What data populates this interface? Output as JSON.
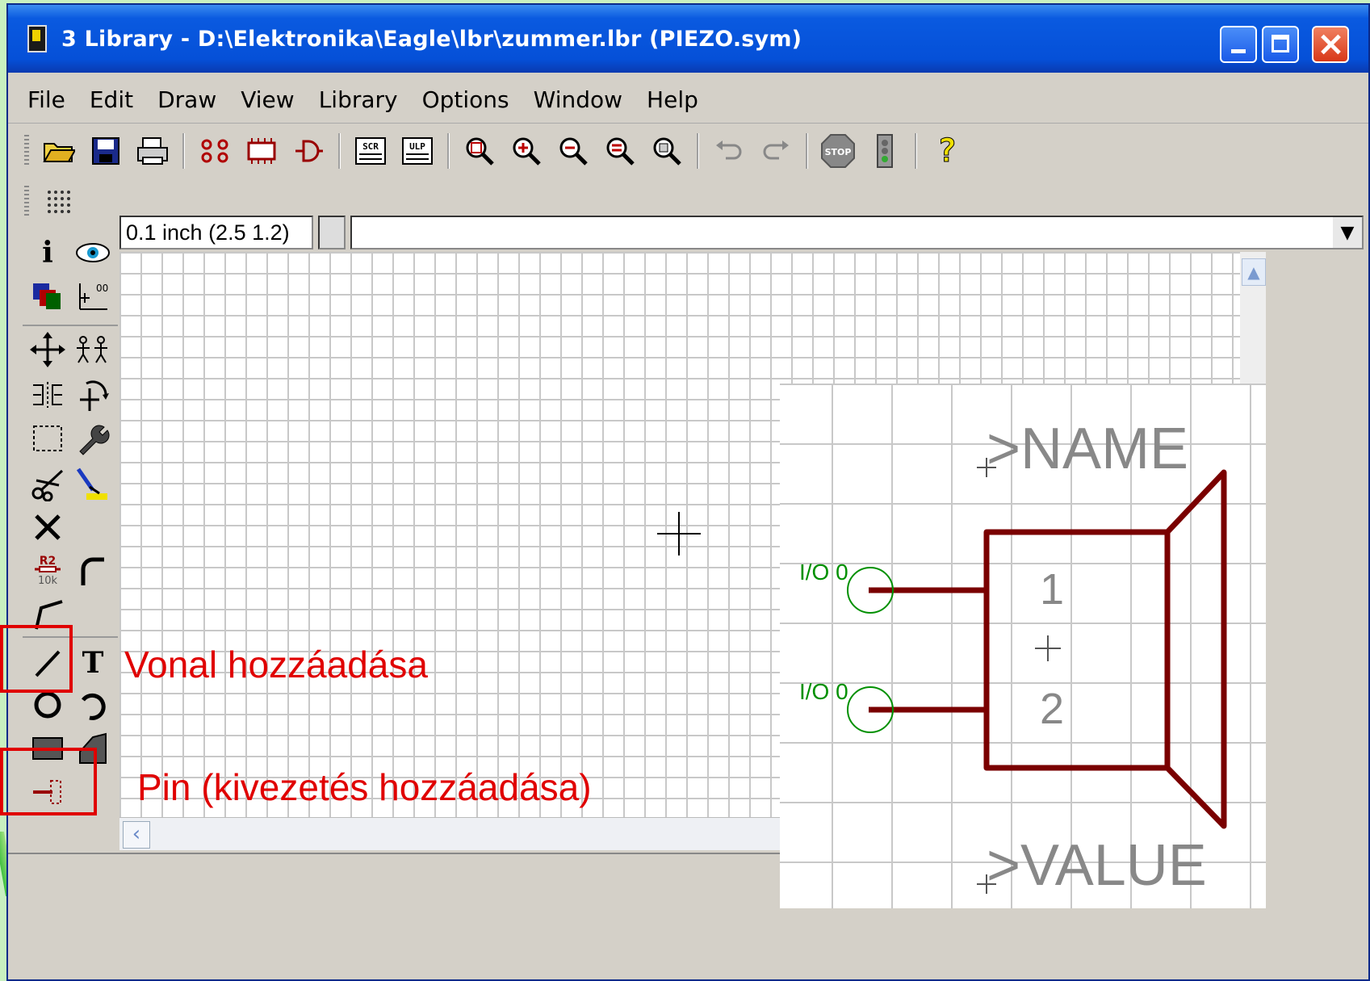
{
  "window": {
    "title": "3 Library - D:\\Elektronika\\Eagle\\lbr\\zummer.lbr (PIEZO.sym)"
  },
  "menu": [
    "File",
    "Edit",
    "Draw",
    "View",
    "Library",
    "Options",
    "Window",
    "Help"
  ],
  "toolbar": {
    "icons": [
      "open-icon",
      "save-icon",
      "print-icon",
      "package-icon",
      "ic-icon",
      "symbol-icon",
      "script-icon",
      "ulp-icon",
      "zoom-fit-icon",
      "zoom-in-icon",
      "zoom-out-icon",
      "zoom-redraw-icon",
      "zoom-select-icon",
      "undo-icon",
      "redo-icon",
      "stop-icon",
      "go-icon",
      "help-icon"
    ],
    "help_glyph": "?",
    "stop_label": "STOP",
    "script_label": "SCR",
    "ulp_label": "ULP"
  },
  "coords": {
    "readout": "0.1 inch (2.5 1.2)",
    "command_value": ""
  },
  "sidebar": {
    "text_tool_glyph": "T",
    "value_tool_label_top": "R2",
    "value_tool_label_bottom": "10k"
  },
  "annotations": {
    "line_tool": "Vonal hozzáadása",
    "pin_tool": "Pin (kivezetés hozzáadása)"
  },
  "symbol": {
    "name_placeholder": ">NAME",
    "value_placeholder": ">VALUE",
    "pins": [
      {
        "label": "I/O 0",
        "number": "1"
      },
      {
        "label": "I/O 0",
        "number": "2"
      }
    ]
  },
  "colors": {
    "symbol_outline": "#7a0000",
    "pin_label": "#009000",
    "annotation": "#e00000",
    "titlebar": "#0550d8"
  }
}
